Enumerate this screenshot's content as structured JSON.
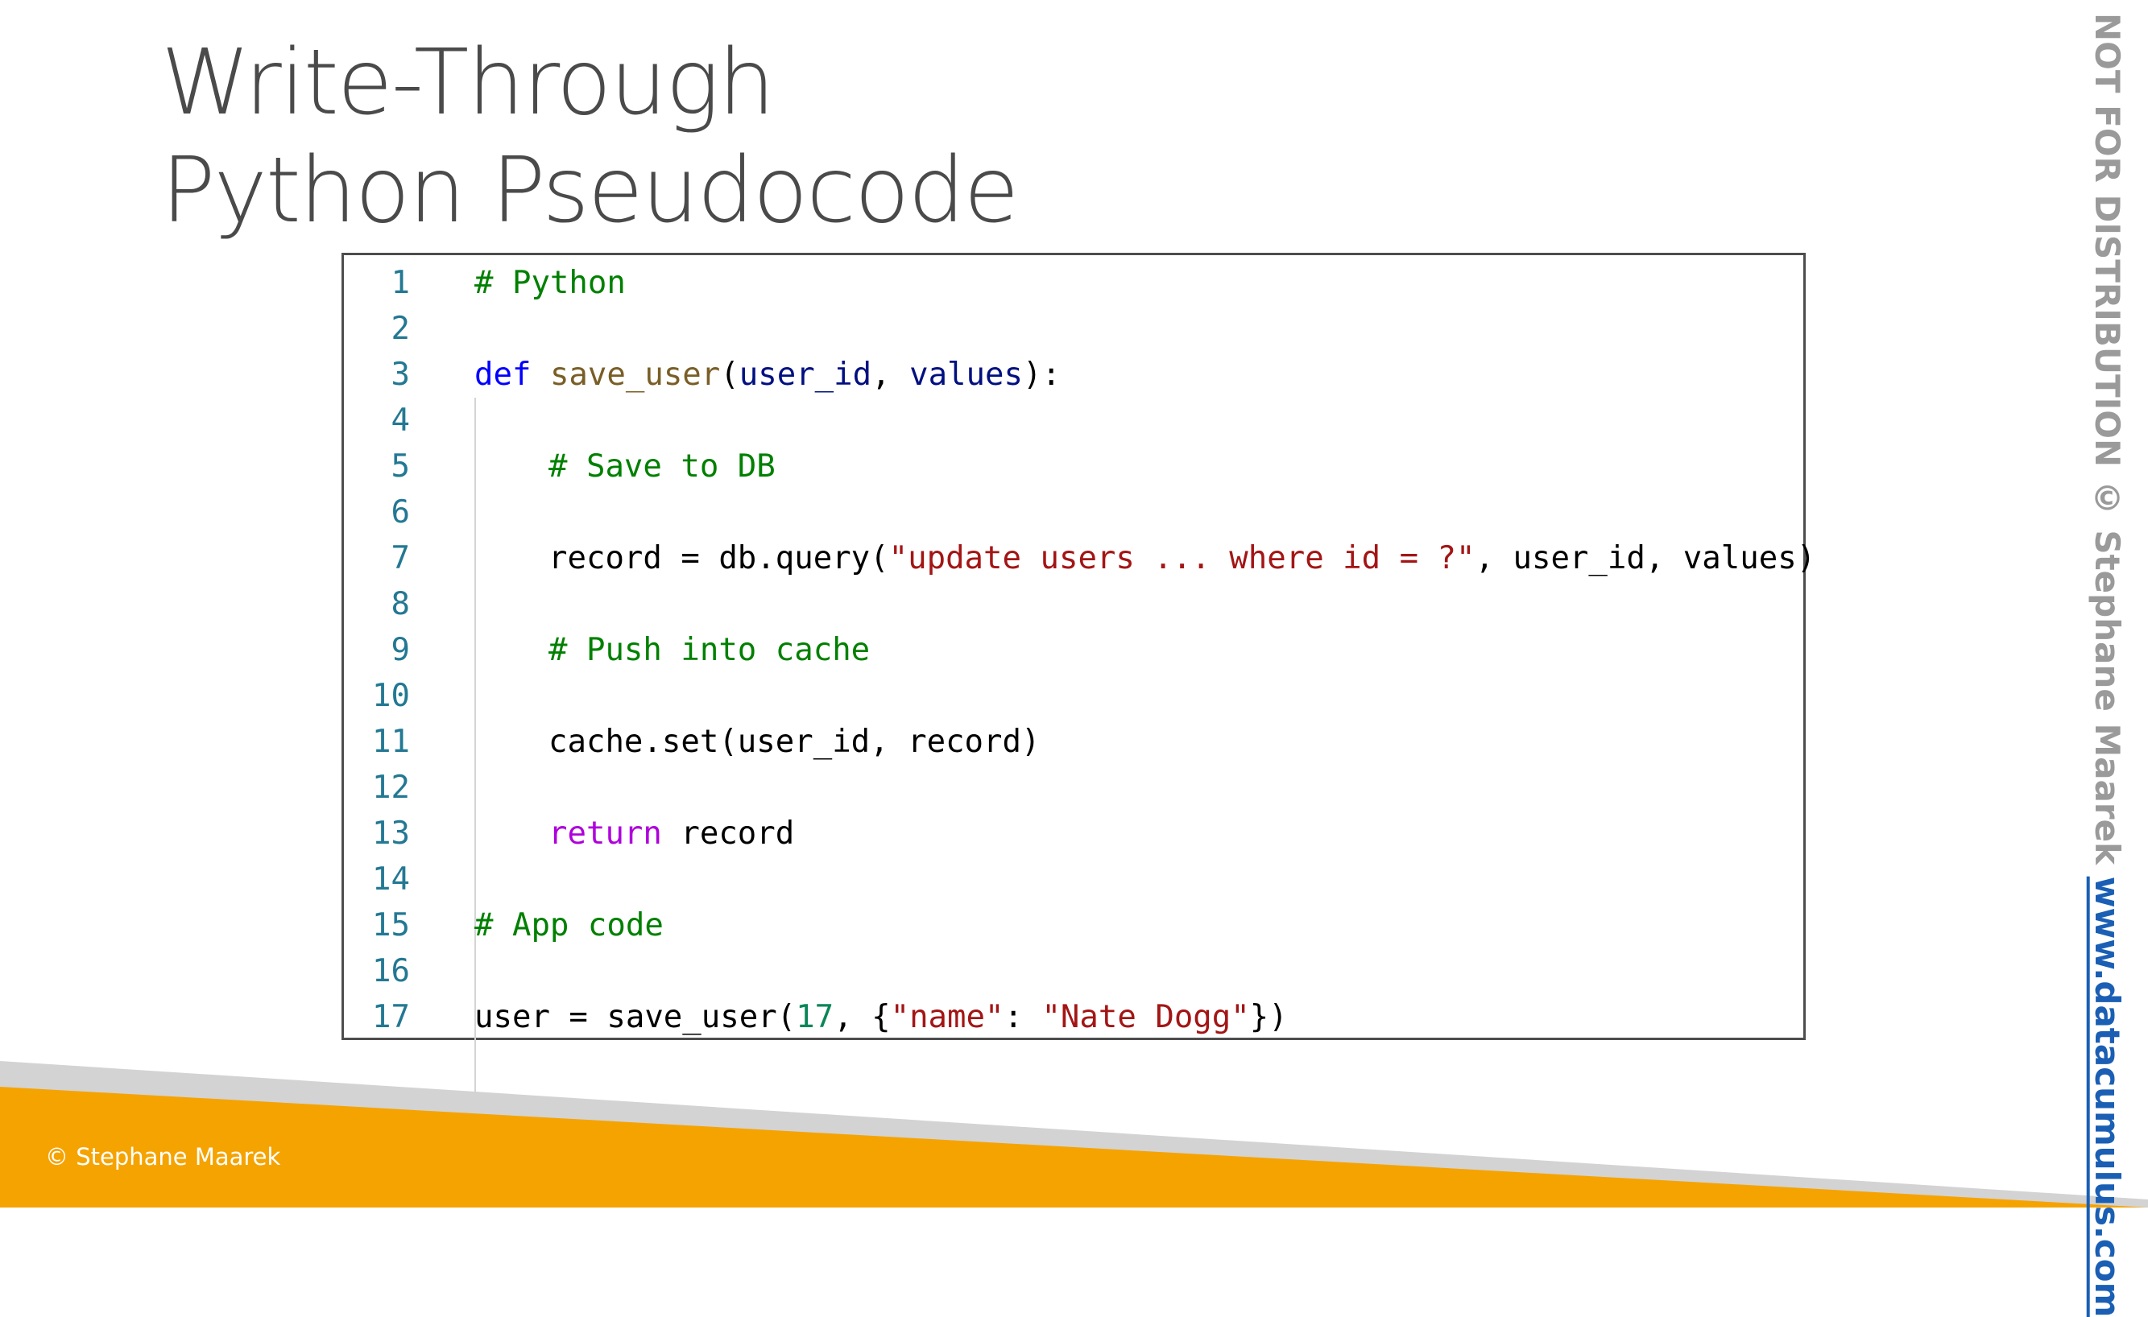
{
  "slide": {
    "title_line1": "Write-Through",
    "title_line2": "Python Pseudocode",
    "footer_credit": "© Stephane Maarek",
    "side_notice": "NOT FOR DISTRIBUTION © Stephane Maarek ",
    "side_link": "www.datacumulus.com"
  },
  "colors": {
    "accent_orange": "#f5a300",
    "band_gray": "#d3d3d3",
    "title_text": "#4a4a4a",
    "line_number": "#237893",
    "comment": "#008000",
    "keyword": "#0000ff",
    "function": "#795e26",
    "string": "#a31515",
    "control": "#af00db",
    "link": "#1a5fb4"
  },
  "code": {
    "language": "python",
    "lines": [
      {
        "n": "1",
        "indent": 0,
        "tokens": [
          {
            "t": "# Python",
            "c": "comment"
          }
        ]
      },
      {
        "n": "2",
        "indent": 0,
        "tokens": []
      },
      {
        "n": "3",
        "indent": 0,
        "tokens": [
          {
            "t": "def",
            "c": "keyword"
          },
          {
            "t": " ",
            "c": "plain"
          },
          {
            "t": "save_user",
            "c": "function"
          },
          {
            "t": "(",
            "c": "plain"
          },
          {
            "t": "user_id",
            "c": "param"
          },
          {
            "t": ", ",
            "c": "plain"
          },
          {
            "t": "values",
            "c": "param"
          },
          {
            "t": "):",
            "c": "plain"
          }
        ]
      },
      {
        "n": "4",
        "indent": 0,
        "tokens": []
      },
      {
        "n": "5",
        "indent": 1,
        "tokens": [
          {
            "t": "# Save to DB",
            "c": "comment"
          }
        ]
      },
      {
        "n": "6",
        "indent": 1,
        "tokens": []
      },
      {
        "n": "7",
        "indent": 1,
        "tokens": [
          {
            "t": "record = db.query(",
            "c": "plain"
          },
          {
            "t": "\"update users ... where id = ?\"",
            "c": "string"
          },
          {
            "t": ", user_id, values)",
            "c": "plain"
          }
        ]
      },
      {
        "n": "8",
        "indent": 1,
        "tokens": []
      },
      {
        "n": "9",
        "indent": 1,
        "tokens": [
          {
            "t": "# Push into cache",
            "c": "comment"
          }
        ]
      },
      {
        "n": "10",
        "indent": 1,
        "tokens": []
      },
      {
        "n": "11",
        "indent": 1,
        "tokens": [
          {
            "t": "cache.set(user_id, record)",
            "c": "plain"
          }
        ]
      },
      {
        "n": "12",
        "indent": 1,
        "tokens": []
      },
      {
        "n": "13",
        "indent": 1,
        "tokens": [
          {
            "t": "return",
            "c": "control"
          },
          {
            "t": " record",
            "c": "plain"
          }
        ]
      },
      {
        "n": "14",
        "indent": 0,
        "tokens": []
      },
      {
        "n": "15",
        "indent": 0,
        "tokens": [
          {
            "t": "# App code",
            "c": "comment"
          }
        ]
      },
      {
        "n": "16",
        "indent": 0,
        "tokens": []
      },
      {
        "n": "17",
        "indent": 0,
        "tokens": [
          {
            "t": "user = save_user(",
            "c": "plain"
          },
          {
            "t": "17",
            "c": "number"
          },
          {
            "t": ", {",
            "c": "plain"
          },
          {
            "t": "\"name\"",
            "c": "string"
          },
          {
            "t": ": ",
            "c": "plain"
          },
          {
            "t": "\"Nate Dogg\"",
            "c": "string"
          },
          {
            "t": "})",
            "c": "plain"
          }
        ]
      }
    ]
  }
}
